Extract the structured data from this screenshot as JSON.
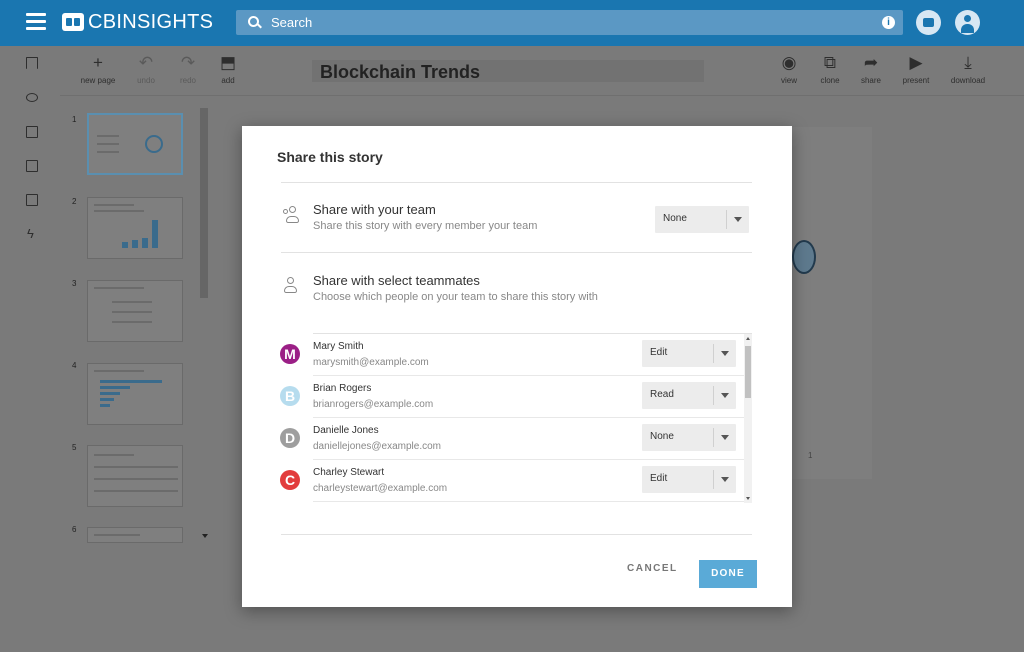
{
  "header": {
    "logo_text": "CBINSIGHTS",
    "search_placeholder": "Search"
  },
  "toolbar": {
    "new_page": "new page",
    "undo": "undo",
    "redo": "redo",
    "add": "add",
    "view": "view",
    "clone": "clone",
    "share": "share",
    "present": "present",
    "download": "download",
    "document_title": "Blockchain Trends"
  },
  "slides": [
    {
      "number": "1"
    },
    {
      "number": "2"
    },
    {
      "number": "3"
    },
    {
      "number": "4"
    },
    {
      "number": "5"
    },
    {
      "number": "6"
    }
  ],
  "canvas": {
    "page_number": "1"
  },
  "modal": {
    "title": "Share this story",
    "team_section": {
      "title": "Share with your team",
      "subtitle": "Share this story with every member your team",
      "selected": "None"
    },
    "select_section": {
      "title": "Share with select teammates",
      "subtitle": "Choose which people on your team to share this story with"
    },
    "teammates": [
      {
        "initial": "M",
        "name": "Mary Smith",
        "email": "marysmith@example.com",
        "permission": "Edit",
        "color": "#9b1f86"
      },
      {
        "initial": "B",
        "name": "Brian Rogers",
        "email": "brianrogers@example.com",
        "permission": "Read",
        "color": "#b6dcee"
      },
      {
        "initial": "D",
        "name": "Danielle Jones",
        "email": "daniellejones@example.com",
        "permission": "None",
        "color": "#9e9e9e"
      },
      {
        "initial": "C",
        "name": "Charley Stewart",
        "email": "charleystewart@example.com",
        "permission": "Edit",
        "color": "#e23c3c"
      }
    ],
    "cancel_label": "CANCEL",
    "done_label": "DONE"
  }
}
